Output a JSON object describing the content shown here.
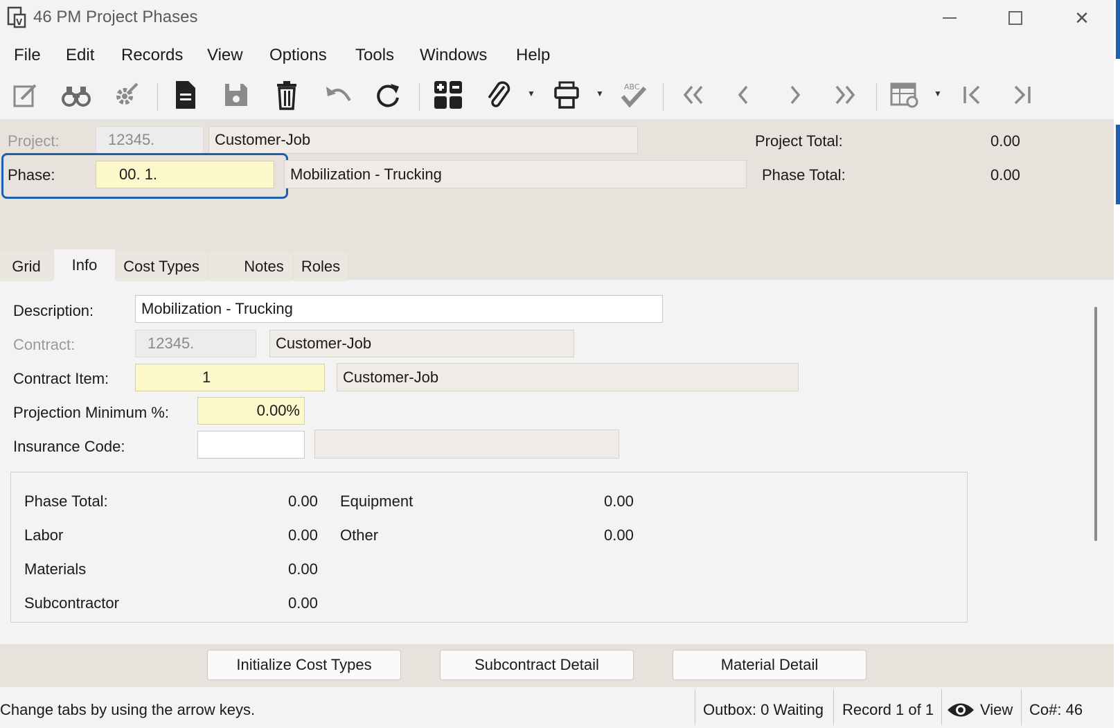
{
  "window": {
    "title": "46 PM Project Phases",
    "app_icon": "viewpoint-form-icon",
    "minimize": "—",
    "maximize": "☐",
    "close": "✕"
  },
  "menu": {
    "items": [
      "File",
      "Edit",
      "Records",
      "View",
      "Options",
      "Tools",
      "Windows",
      "Help"
    ]
  },
  "toolbar": {
    "icons": [
      "edit-icon",
      "find-icon",
      "settings-icon",
      "new-record-icon",
      "save-icon",
      "delete-icon",
      "undo-icon",
      "refresh-icon",
      "grid-calculator-icon",
      "attachment-icon",
      "print-icon",
      "spellcheck-icon",
      "first-record-icon",
      "previous-record-icon",
      "next-record-icon",
      "last-record-icon",
      "form-settings-icon",
      "first-icon",
      "last-icon"
    ]
  },
  "header": {
    "project_label": "Project:",
    "project_value": "12345.",
    "project_desc": "Customer-Job",
    "project_total_label": "Project Total:",
    "project_total_value": "0.00",
    "phase_label": "Phase:",
    "phase_value": "00.  1.",
    "phase_desc": "Mobilization - Trucking",
    "phase_total_label": "Phase Total:",
    "phase_total_value": "0.00"
  },
  "tabs": [
    {
      "label": "Grid"
    },
    {
      "label": "Info",
      "active": true
    },
    {
      "label": "Cost Types"
    },
    {
      "label": "Notes"
    },
    {
      "label": "Roles"
    }
  ],
  "info": {
    "description_label": "Description:",
    "description_value": "Mobilization - Trucking",
    "contract_label": "Contract:",
    "contract_value": "12345.",
    "contract_desc": "Customer-Job",
    "contract_item_label": "Contract Item:",
    "contract_item_value": "1",
    "contract_item_desc": "Customer-Job",
    "projection_label": "Projection Minimum %:",
    "projection_value": "0.00%",
    "insurance_label": "Insurance Code:",
    "insurance_value": "",
    "insurance_desc": ""
  },
  "totals": {
    "phase_total_label": "Phase Total:",
    "phase_total_value": "0.00",
    "labor_label": "Labor",
    "labor_value": "0.00",
    "materials_label": "Materials",
    "materials_value": "0.00",
    "subcontractor_label": "Subcontractor",
    "subcontractor_value": "0.00",
    "equipment_label": "Equipment",
    "equipment_value": "0.00",
    "other_label": "Other",
    "other_value": "0.00"
  },
  "buttons": {
    "initialize": "Initialize Cost Types",
    "subcontract": "Subcontract Detail",
    "material": "Material Detail"
  },
  "status": {
    "hint": "Change tabs by using the arrow keys.",
    "outbox": "Outbox: 0 Waiting",
    "record": "Record 1 of 1",
    "view": "View",
    "company": "Co#: 46"
  },
  "colors": {
    "accent": "#1f5fb0",
    "required_field": "#fcf8cc",
    "header_bg": "#e8e2dc"
  }
}
